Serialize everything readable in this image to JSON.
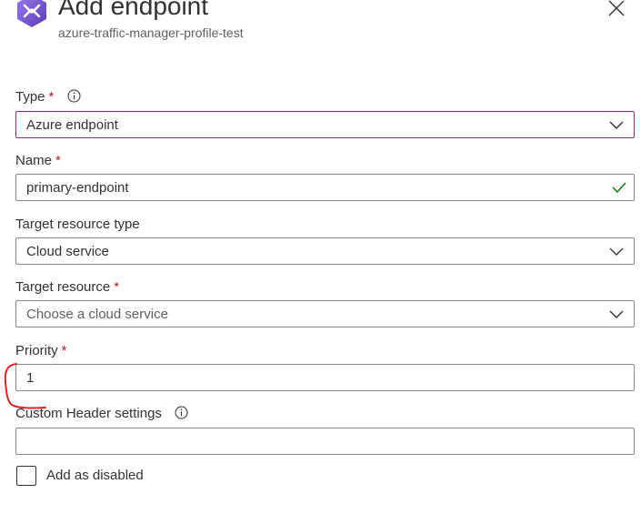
{
  "header": {
    "title": "Add endpoint",
    "subtitle": "azure-traffic-manager-profile-test",
    "logo_icon": "traffic-manager-icon",
    "close_icon": "close-icon"
  },
  "form": {
    "type": {
      "label": "Type",
      "required_mark": "*",
      "value": "Azure endpoint"
    },
    "name": {
      "label": "Name",
      "required_mark": "*",
      "value": "primary-endpoint",
      "validated": true
    },
    "target_resource_type": {
      "label": "Target resource type",
      "value": "Cloud service"
    },
    "target_resource": {
      "label": "Target resource",
      "required_mark": "*",
      "placeholder": "Choose a cloud service"
    },
    "priority": {
      "label": "Priority",
      "required_mark": "*",
      "value": "1"
    },
    "custom_header": {
      "label": "Custom Header settings",
      "value": ""
    },
    "disabled_checkbox": {
      "label": "Add as disabled",
      "checked": false
    }
  },
  "colors": {
    "focus_border": "#8b2a8b",
    "required": "#a4262c",
    "valid_check": "#107c10",
    "annotation": "#d9242c",
    "logo_purple": "#7a55d3"
  }
}
